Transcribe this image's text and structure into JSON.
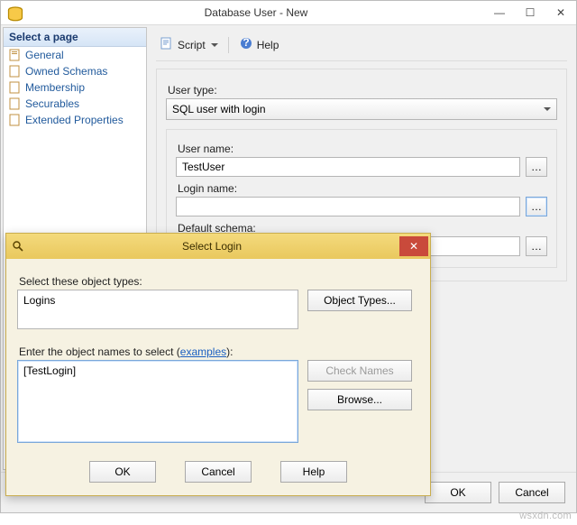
{
  "window": {
    "title": "Database User - New",
    "buttons": {
      "min": "—",
      "max": "☐",
      "close": "✕"
    }
  },
  "sidebar": {
    "header": "Select a page",
    "items": [
      {
        "label": "General"
      },
      {
        "label": "Owned Schemas"
      },
      {
        "label": "Membership"
      },
      {
        "label": "Securables"
      },
      {
        "label": "Extended Properties"
      }
    ]
  },
  "toolbar": {
    "script_label": "Script",
    "help_label": "Help"
  },
  "form": {
    "user_type_label": "User type:",
    "user_type_value": "SQL user with login",
    "user_name_label": "User name:",
    "user_name_value": "TestUser",
    "login_name_label": "Login name:",
    "login_name_value": "",
    "default_schema_label": "Default schema:",
    "default_schema_value": ""
  },
  "footer": {
    "ok": "OK",
    "cancel": "Cancel"
  },
  "dialog": {
    "title": "Select Login",
    "types_label": "Select these object types:",
    "types_value": "Logins",
    "object_types_btn": "Object Types...",
    "names_label_a": "Enter the object names to select (",
    "names_label_link": "examples",
    "names_label_b": "):",
    "names_value": "[TestLogin]",
    "check_names_btn": "Check Names",
    "browse_btn": "Browse...",
    "ok": "OK",
    "cancel": "Cancel",
    "help": "Help",
    "close": "✕"
  },
  "watermark": "wsxdn.com"
}
